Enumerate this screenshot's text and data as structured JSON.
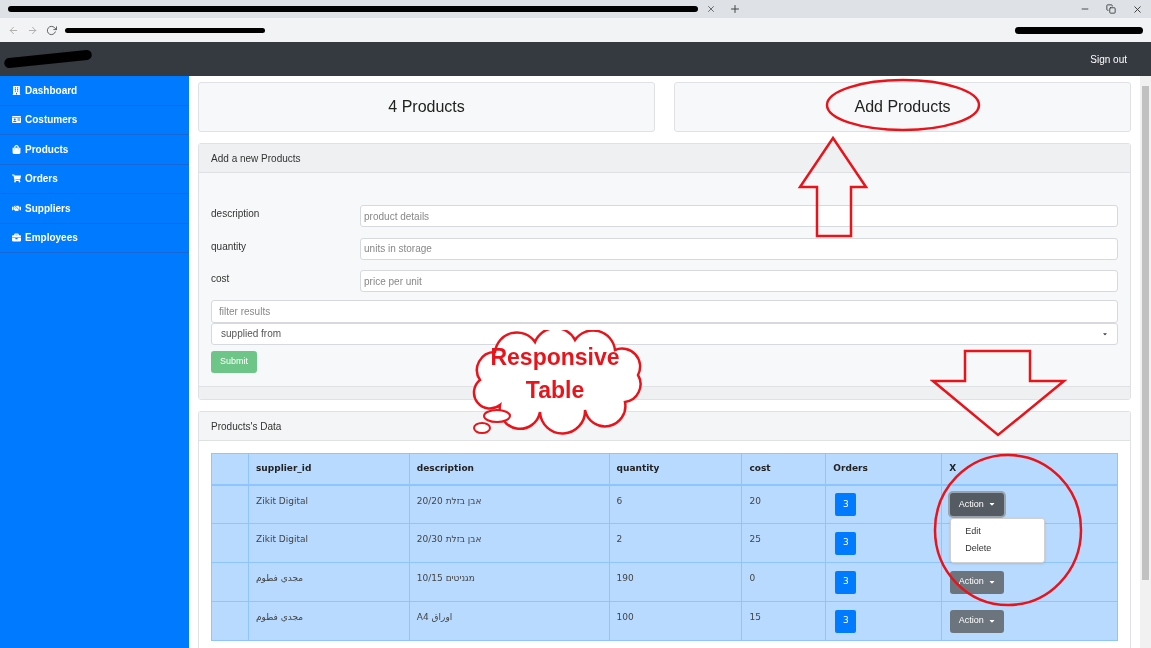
{
  "navbar": {
    "sign_out": "Sign out"
  },
  "sidebar": {
    "items": [
      {
        "label": "Dashboard"
      },
      {
        "label": "Costumers"
      },
      {
        "label": "Products"
      },
      {
        "label": "Orders"
      },
      {
        "label": "Suppliers"
      },
      {
        "label": "Employees"
      }
    ]
  },
  "summary_cards": [
    {
      "title": "4 Products"
    },
    {
      "title": "Add Products"
    }
  ],
  "form": {
    "title": "Add a new Products",
    "fields": [
      {
        "label": "description",
        "placeholder": "product details"
      },
      {
        "label": "quantity",
        "placeholder": "units in storage"
      },
      {
        "label": "cost",
        "placeholder": "price per unit"
      }
    ],
    "filter": {
      "placeholder": "filter results"
    },
    "select": {
      "value": "supplied from"
    },
    "submit": "Submit"
  },
  "table": {
    "title": "Products's Data",
    "columns": [
      "supplier_id",
      "description",
      "quantity",
      "cost",
      "Orders",
      "X"
    ],
    "rows": [
      {
        "supplier_id": "Zikit Digital",
        "description": "אבן בזלת 20/20",
        "quantity": "6",
        "cost": "20",
        "orders": "3",
        "action": "Action",
        "expanded": true,
        "menu": [
          "Edit",
          "Delete"
        ]
      },
      {
        "supplier_id": "Zikit Digital",
        "description": "אבן בזלת 20/30",
        "quantity": "2",
        "cost": "25",
        "orders": "3"
      },
      {
        "supplier_id": "مجدي فطوم",
        "description": "מגניטים 10/15",
        "quantity": "190",
        "cost": "0",
        "orders": "3",
        "action": "Action",
        "expanded": false
      },
      {
        "supplier_id": "مجدي فطوم",
        "description": "A4 اوراق",
        "quantity": "100",
        "cost": "15",
        "orders": "3",
        "action": "Action",
        "expanded": false
      }
    ]
  },
  "annotation": {
    "callout": [
      "Responsive",
      "Table"
    ]
  }
}
